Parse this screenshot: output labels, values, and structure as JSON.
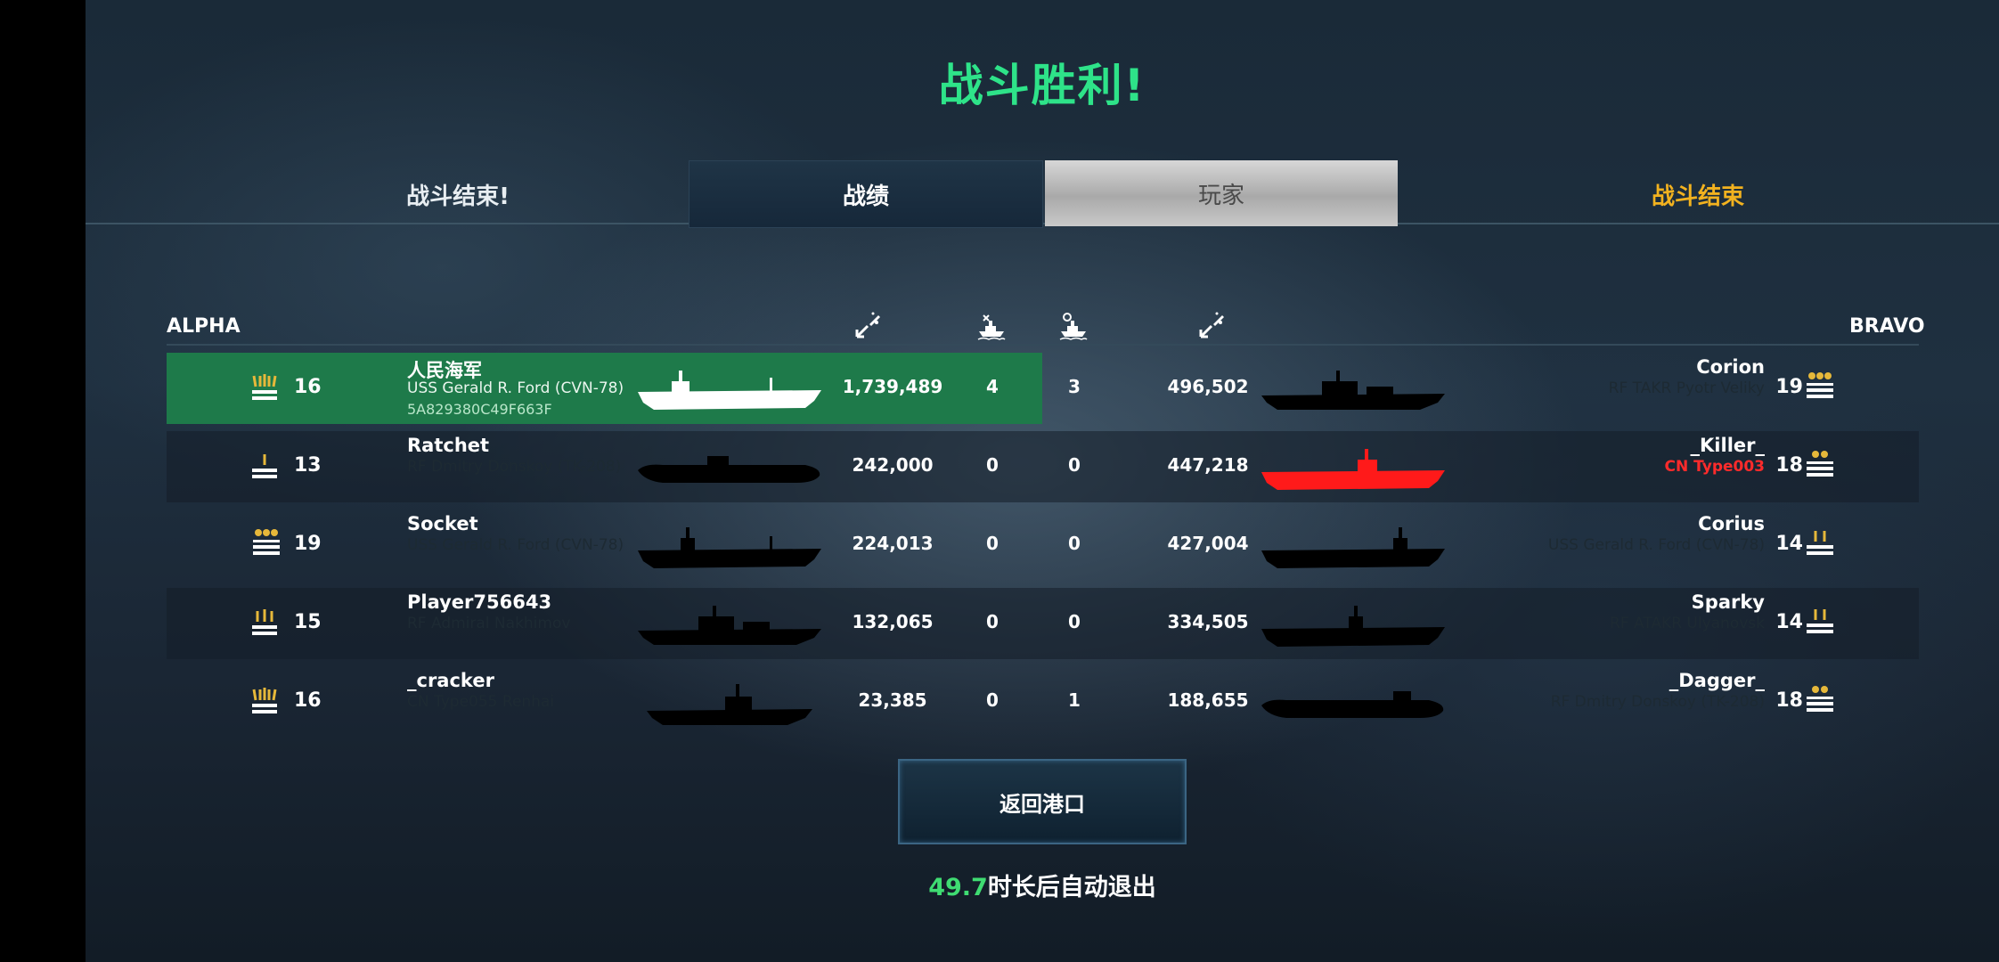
{
  "title": "战斗胜利!",
  "tabs": {
    "left_label": "战斗结束!",
    "stats": "战绩",
    "players": "玩家",
    "right_label": "战斗结束"
  },
  "teams": {
    "alpha": "ALPHA",
    "bravo": "BRAVO"
  },
  "header_icons": [
    "damage-dealt-icon",
    "ships-sunk-icon",
    "ships-assisted-icon",
    "damage-taken-icon"
  ],
  "rows": [
    {
      "left": {
        "rank": "16",
        "rank_icon": "rank-insignia-icon",
        "name": "人民海军",
        "ship": "USS Gerald R. Ford (CVN-78)",
        "id": "5A829380C49F663F",
        "ship_icon": "aircraft-carrier-silhouette"
      },
      "damage": "1,739,489",
      "kills": "4",
      "assists": "3",
      "taken": "496,502",
      "right": {
        "name": "Corion",
        "ship": "RF TAKR Pyotr Veliky",
        "rank": "19",
        "rank_icon": "rank-insignia-icon",
        "ship_icon": "cruiser-silhouette"
      }
    },
    {
      "left": {
        "rank": "13",
        "rank_icon": "rank-insignia-icon",
        "name": "Ratchet",
        "ship": "RF Dmitry Donskoy (TK-208)",
        "ship_icon": "submarine-silhouette"
      },
      "damage": "242,000",
      "kills": "0",
      "assists": "0",
      "taken": "447,218",
      "right": {
        "name": "_Killer_",
        "ship": "CN Type003",
        "rank": "18",
        "rank_icon": "rank-insignia-icon",
        "ship_icon": "aircraft-carrier-silhouette-red"
      }
    },
    {
      "left": {
        "rank": "19",
        "rank_icon": "rank-insignia-icon",
        "name": "Socket",
        "ship": "USS Gerald R. Ford (CVN-78)",
        "ship_icon": "aircraft-carrier-silhouette"
      },
      "damage": "224,013",
      "kills": "0",
      "assists": "0",
      "taken": "427,004",
      "right": {
        "name": "Corius",
        "ship": "USS Gerald R. Ford (CVN-78)",
        "rank": "14",
        "rank_icon": "rank-insignia-icon",
        "ship_icon": "aircraft-carrier-silhouette"
      }
    },
    {
      "left": {
        "rank": "15",
        "rank_icon": "rank-insignia-icon",
        "name": "Player756643",
        "ship": "RF Admiral Nakhimov",
        "ship_icon": "cruiser-silhouette"
      },
      "damage": "132,065",
      "kills": "0",
      "assists": "0",
      "taken": "334,505",
      "right": {
        "name": "Sparky",
        "ship": "RF ATAKR Ulyanovsk",
        "rank": "14",
        "rank_icon": "rank-insignia-icon",
        "ship_icon": "aircraft-carrier-silhouette"
      }
    },
    {
      "left": {
        "rank": "16",
        "rank_icon": "rank-insignia-icon",
        "name": "_cracker",
        "ship": "CN Type055 Renhai",
        "ship_icon": "destroyer-silhouette"
      },
      "damage": "23,385",
      "kills": "0",
      "assists": "1",
      "taken": "188,655",
      "right": {
        "name": "_Dagger_",
        "ship": "RF Dmitry Donskoy (TK-208)",
        "rank": "18",
        "rank_icon": "rank-insignia-icon",
        "ship_icon": "submarine-silhouette"
      }
    }
  ],
  "back_button": "返回港口",
  "auto_exit": {
    "seconds": "49.7",
    "text": "时长后自动退出"
  },
  "colors": {
    "victory": "#2ee389",
    "highlight_row": "#1e7a4a",
    "gold": "#f2b21f",
    "enemy_red": "#ff2b2b"
  }
}
